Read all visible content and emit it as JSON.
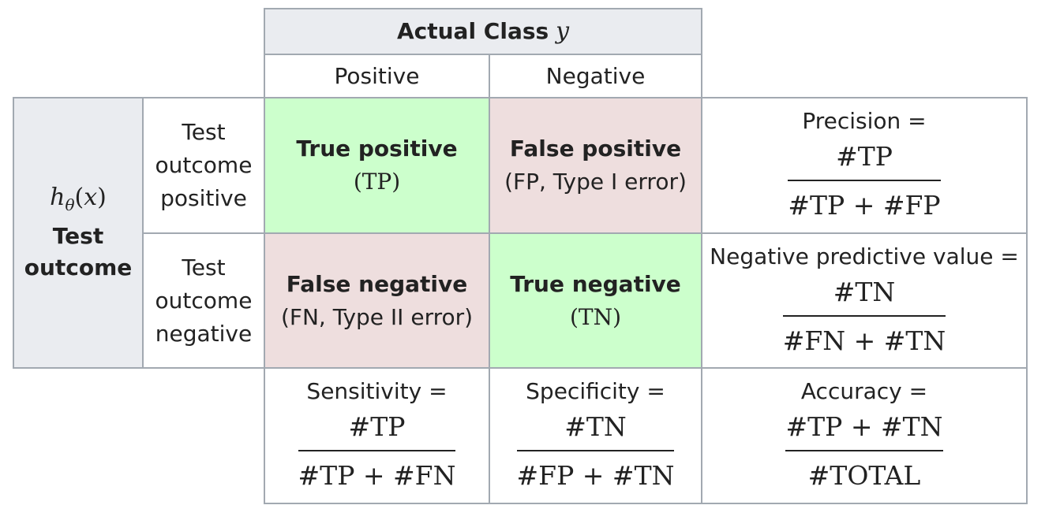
{
  "header": {
    "actual_class_label": "Actual Class",
    "actual_class_var": "y",
    "positive": "Positive",
    "negative": "Negative"
  },
  "row_header": {
    "symbol": "hθ(x)",
    "title_line1": "Test",
    "title_line2": "outcome"
  },
  "rows": [
    {
      "label_lines": [
        "Test",
        "outcome",
        "positive"
      ]
    },
    {
      "label_lines": [
        "Test",
        "outcome",
        "negative"
      ]
    }
  ],
  "cells": {
    "tp": {
      "title": "True positive",
      "sub": "(TP)"
    },
    "fp": {
      "title": "False positive",
      "sub": "(FP, Type I error)"
    },
    "fn": {
      "title": "False negative",
      "sub": "(FN, Type II error)"
    },
    "tn": {
      "title": "True negative",
      "sub": "(TN)"
    }
  },
  "metrics": {
    "precision": {
      "label": "Precision =",
      "num": "#TP",
      "den": "#TP + #FP"
    },
    "npv": {
      "label": "Negative predictive value =",
      "num": "#TN",
      "den": "#FN + #TN"
    },
    "sensitivity": {
      "label": "Sensitivity =",
      "num": "#TP",
      "den": "#TP + #FN"
    },
    "specificity": {
      "label": "Specificity =",
      "num": "#TN",
      "den": "#FP + #TN"
    },
    "accuracy": {
      "label": "Accuracy =",
      "num": "#TP + #TN",
      "den": "#TOTAL"
    }
  },
  "colors": {
    "border": "#a2a9b1",
    "header_bg": "#eaecf0",
    "true_bg": "#ccffcc",
    "false_bg": "#eedede"
  }
}
